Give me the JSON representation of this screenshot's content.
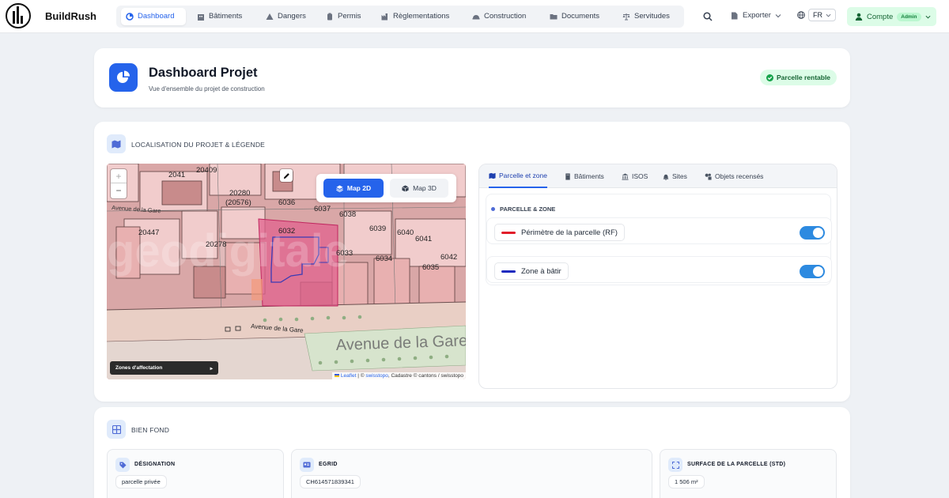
{
  "app": {
    "brand": "BuildRush"
  },
  "nav": {
    "items": [
      {
        "label": "Dashboard",
        "icon": "dashboard-icon",
        "active": true
      },
      {
        "label": "Bâtiments",
        "icon": "building-icon"
      },
      {
        "label": "Dangers",
        "icon": "warning-icon"
      },
      {
        "label": "Permis",
        "icon": "clipboard-icon"
      },
      {
        "label": "Règlementations",
        "icon": "industry-icon"
      },
      {
        "label": "Construction",
        "icon": "helmet-icon"
      },
      {
        "label": "Documents",
        "icon": "folder-icon"
      },
      {
        "label": "Servitudes",
        "icon": "scale-icon"
      }
    ],
    "export_label": "Exporter",
    "lang": "FR",
    "account_label": "Compte",
    "account_badge": "Admin"
  },
  "header": {
    "title": "Dashboard Projet",
    "subtitle": "Vue d'ensemble du projet de construction",
    "status": "Parcelle rentable"
  },
  "location": {
    "section_title": "LOCALISATION DU PROJET & LÉGENDE",
    "map": {
      "zoom_in": "+",
      "zoom_out": "−",
      "mode_2d": "Map 2D",
      "mode_3d": "Map 3D",
      "zones_label": "Zones d'affectation",
      "zones_arrow": "▸",
      "attribution_leaflet": "Leaflet",
      "attribution_sep": " | © ",
      "attribution_swisstopo": "swisstopo",
      "attribution_rest": ", Cadastre © cantons / swisstopo",
      "labels": [
        {
          "text": "20409"
        },
        {
          "text": "2041"
        },
        {
          "text": "20280"
        },
        {
          "text": "(20576)"
        },
        {
          "text": "6036"
        },
        {
          "text": "6037"
        },
        {
          "text": "6038"
        },
        {
          "text": "20447"
        },
        {
          "text": "6032"
        },
        {
          "text": "6039"
        },
        {
          "text": "6040"
        },
        {
          "text": "6041"
        },
        {
          "text": "20278"
        },
        {
          "text": "6033"
        },
        {
          "text": "6034"
        },
        {
          "text": "6042"
        },
        {
          "text": "6035"
        },
        {
          "text": "Avenue de la Gare"
        },
        {
          "text": "Avenue de la Gare"
        },
        {
          "text": "Avenue de la Gare"
        },
        {
          "text": "geodigitale"
        }
      ]
    },
    "tabs": [
      {
        "label": "Parcelle et zone",
        "icon": "map-icon",
        "active": true
      },
      {
        "label": "Bâtiments",
        "icon": "building-icon"
      },
      {
        "label": "ISOS",
        "icon": "landmark-icon"
      },
      {
        "label": "Sites",
        "icon": "bell-icon"
      },
      {
        "label": "Objets recensés",
        "icon": "objects-icon"
      }
    ],
    "panel_title": "PARCELLE & ZONE",
    "layers": [
      {
        "label": "Périmètre de la parcelle (RF)",
        "color": "#e11d2a",
        "on": true
      },
      {
        "label": "Zone à bâtir",
        "color": "#1e2bbf",
        "on": true
      }
    ]
  },
  "bien_fond": {
    "section_title": "BIEN FOND",
    "cells": [
      {
        "label": "DÉSIGNATION",
        "value": "parcelle privée",
        "icon": "tag-icon"
      },
      {
        "label": "EGRID",
        "value": "CH614571839341",
        "icon": "id-card-icon"
      },
      {
        "label": "SURFACE DE LA PARCELLE (STD)",
        "value": "1 506 m²",
        "icon": "expand-icon"
      }
    ]
  },
  "colors": {
    "accent": "#2563eb",
    "success": "#16a34a",
    "success_bg": "#dcfce7"
  }
}
